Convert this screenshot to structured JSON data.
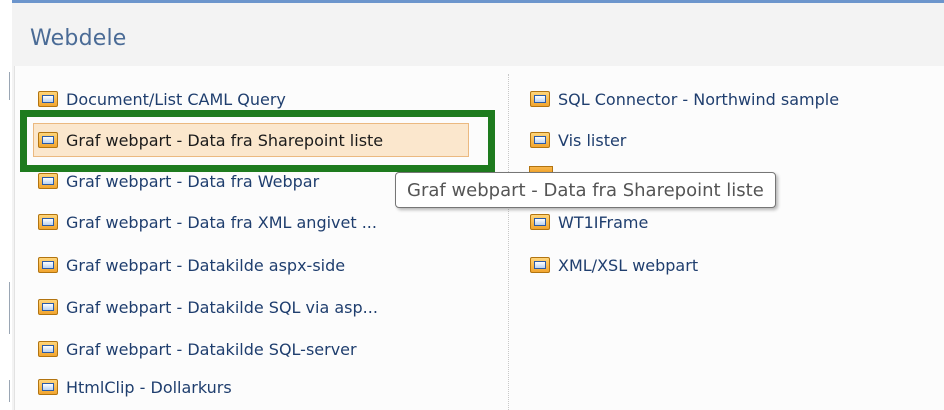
{
  "panel": {
    "title": "Webdele"
  },
  "left_column": {
    "items": [
      {
        "label": "Document/List CAML Query",
        "icon": "webpart-icon"
      },
      {
        "label": "Graf webpart - Data fra Sharepoint liste",
        "icon": "webpart-icon",
        "selected": true
      },
      {
        "label": "Graf webpart - Data fra Webpar",
        "icon": "webpart-icon"
      },
      {
        "label": "Graf webpart - Data fra XML angivet ...",
        "icon": "webpart-icon"
      },
      {
        "label": "Graf webpart - Datakilde aspx-side",
        "icon": "webpart-icon"
      },
      {
        "label": "Graf webpart - Datakilde SQL via asp...",
        "icon": "webpart-icon"
      },
      {
        "label": "Graf webpart - Datakilde SQL-server",
        "icon": "webpart-icon"
      },
      {
        "label": "HtmlClip - Dollarkurs",
        "icon": "webpart-icon"
      }
    ]
  },
  "right_column": {
    "items": [
      {
        "label": "SQL Connector - Northwind sample",
        "icon": "webpart-icon"
      },
      {
        "label": "Vis lister",
        "icon": "webpart-icon"
      },
      {
        "label": "WT1IFrame",
        "icon": "webpart-icon"
      },
      {
        "label": "XML/XSL webpart",
        "icon": "webpart-icon"
      }
    ]
  },
  "tooltip": {
    "text": "Graf webpart - Data fra Sharepoint liste"
  },
  "colors": {
    "title": "#4a6b96",
    "link": "#1f3e6e",
    "selected_background": "#fbe7cd",
    "highlight_frame": "#1e7b1e",
    "top_line": "#6c95cc"
  }
}
